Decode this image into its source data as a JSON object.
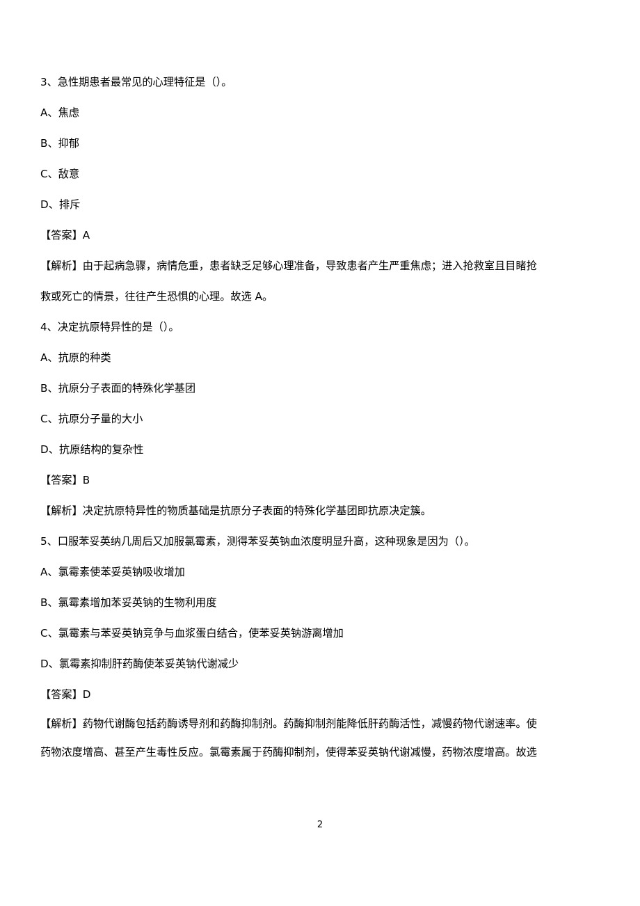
{
  "document": {
    "page_number": "2",
    "blocks": [
      {
        "type": "question_stem",
        "text": "3、急性期患者最常见的心理特征是（）。"
      },
      {
        "type": "option",
        "text": "A、焦虑"
      },
      {
        "type": "option",
        "text": "B、抑郁"
      },
      {
        "type": "option",
        "text": "C、敌意"
      },
      {
        "type": "option",
        "text": "D、排斥"
      },
      {
        "type": "answer",
        "text": "【答案】A"
      },
      {
        "type": "explanation",
        "text": "【解析】由于起病急骤，病情危重，患者缺乏足够心理准备，导致患者产生严重焦虑；进入抢救室且目睹抢"
      },
      {
        "type": "explanation",
        "text": "救或死亡的情景，往往产生恐惧的心理。故选 A。"
      },
      {
        "type": "question_stem",
        "text": "4、决定抗原特异性的是（）。"
      },
      {
        "type": "option",
        "text": "A、抗原的种类"
      },
      {
        "type": "option",
        "text": "B、抗原分子表面的特殊化学基团"
      },
      {
        "type": "option",
        "text": "C、抗原分子量的大小"
      },
      {
        "type": "option",
        "text": "D、抗原结构的复杂性"
      },
      {
        "type": "answer",
        "text": "【答案】B"
      },
      {
        "type": "explanation",
        "text": "【解析】决定抗原特异性的物质基础是抗原分子表面的特殊化学基团即抗原决定簇。"
      },
      {
        "type": "question_stem",
        "text": "5、口服苯妥英纳几周后又加服氯霉素，测得苯妥英钠血浓度明显升高，这种现象是因为（）。"
      },
      {
        "type": "option",
        "text": "A、氯霉素使苯妥英钠吸收增加"
      },
      {
        "type": "option",
        "text": "B、氯霉素增加苯妥英钠的生物利用度"
      },
      {
        "type": "option",
        "text": "C、氯霉素与苯妥英钠竞争与血浆蛋白结合，使苯妥英钠游离增加"
      },
      {
        "type": "option",
        "text": "D、氯霉素抑制肝药酶使苯妥英钠代谢减少"
      },
      {
        "type": "answer",
        "text": "【答案】D"
      },
      {
        "type": "explanation",
        "text": "【解析】药物代谢酶包括药酶诱导剂和药酶抑制剂。药酶抑制剂能降低肝药酶活性，减慢药物代谢速率。使"
      },
      {
        "type": "explanation",
        "text": "药物浓度增高、甚至产生毒性反应。氯霉素属于药酶抑制剂，使得苯妥英钠代谢减慢，药物浓度增高。故选"
      }
    ]
  }
}
